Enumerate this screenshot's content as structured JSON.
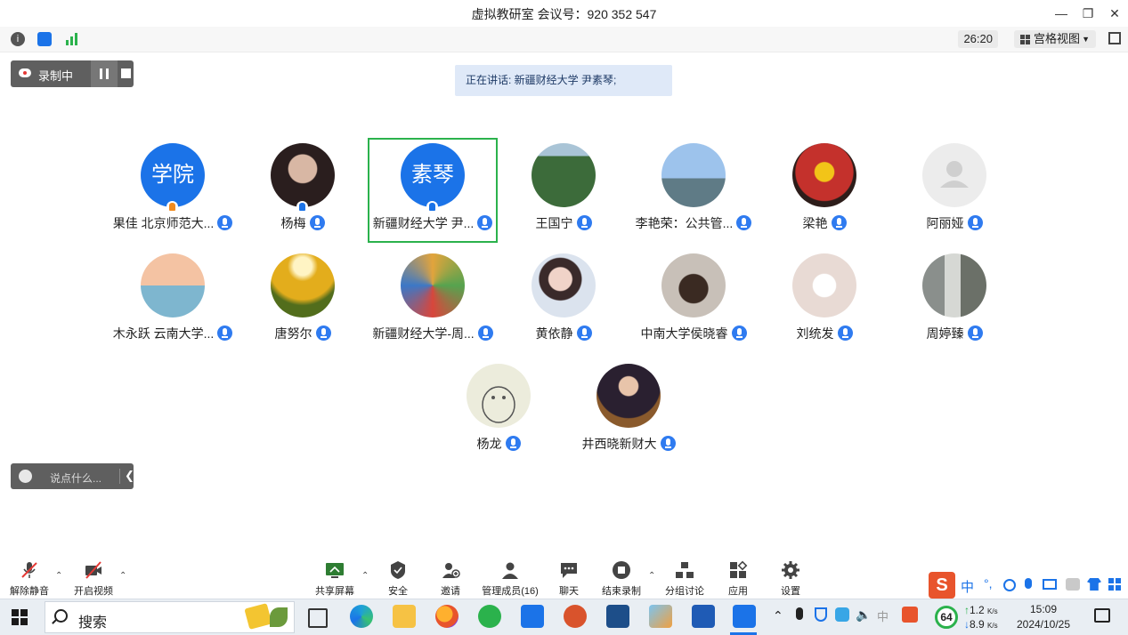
{
  "window": {
    "title": "虚拟教研室 会议号：920 352 547"
  },
  "infobar": {
    "timer": "26:20",
    "view_label": "宫格视图"
  },
  "recording": {
    "label": "录制中"
  },
  "speaking": {
    "text": "正在讲话: 新疆财经大学 尹素琴;"
  },
  "participants": [
    {
      "name": "果佳 北京师范大...",
      "avatar_text": "学院"
    },
    {
      "name": "杨梅"
    },
    {
      "name": "新疆财经大学 尹...",
      "avatar_text": "素琴"
    },
    {
      "name": "王国宁"
    },
    {
      "name": "李艳荣：公共管..."
    },
    {
      "name": "梁艳"
    },
    {
      "name": "阿丽娅"
    },
    {
      "name": "木永跃 云南大学..."
    },
    {
      "name": "唐努尔"
    },
    {
      "name": "新疆财经大学-周..."
    },
    {
      "name": "黄依静"
    },
    {
      "name": "中南大学侯晓睿"
    },
    {
      "name": "刘统发"
    },
    {
      "name": "周婷臻"
    },
    {
      "name": "杨龙"
    },
    {
      "name": "井西晓新财大"
    }
  ],
  "chat": {
    "placeholder": "说点什么..."
  },
  "toolbar": {
    "unmute": "解除静音",
    "start_video": "开启视频",
    "share_screen": "共享屏幕",
    "security": "安全",
    "invite": "邀请",
    "manage_members": "管理成员(16)",
    "chat": "聊天",
    "end_recording": "结束录制",
    "breakout": "分组讨论",
    "apps": "应用",
    "settings": "设置"
  },
  "ime": {
    "mode": "中",
    "punct": "°,"
  },
  "taskbar": {
    "search": "搜索",
    "battery": "64",
    "net_up": "1.2",
    "net_down": "8.9",
    "net_unit": "K/s",
    "time": "15:09",
    "date": "2024/10/25"
  },
  "colors": {
    "accent": "#1b73e8",
    "active_border": "#2bb24c",
    "speaking_bg": "#dfe9f8"
  }
}
